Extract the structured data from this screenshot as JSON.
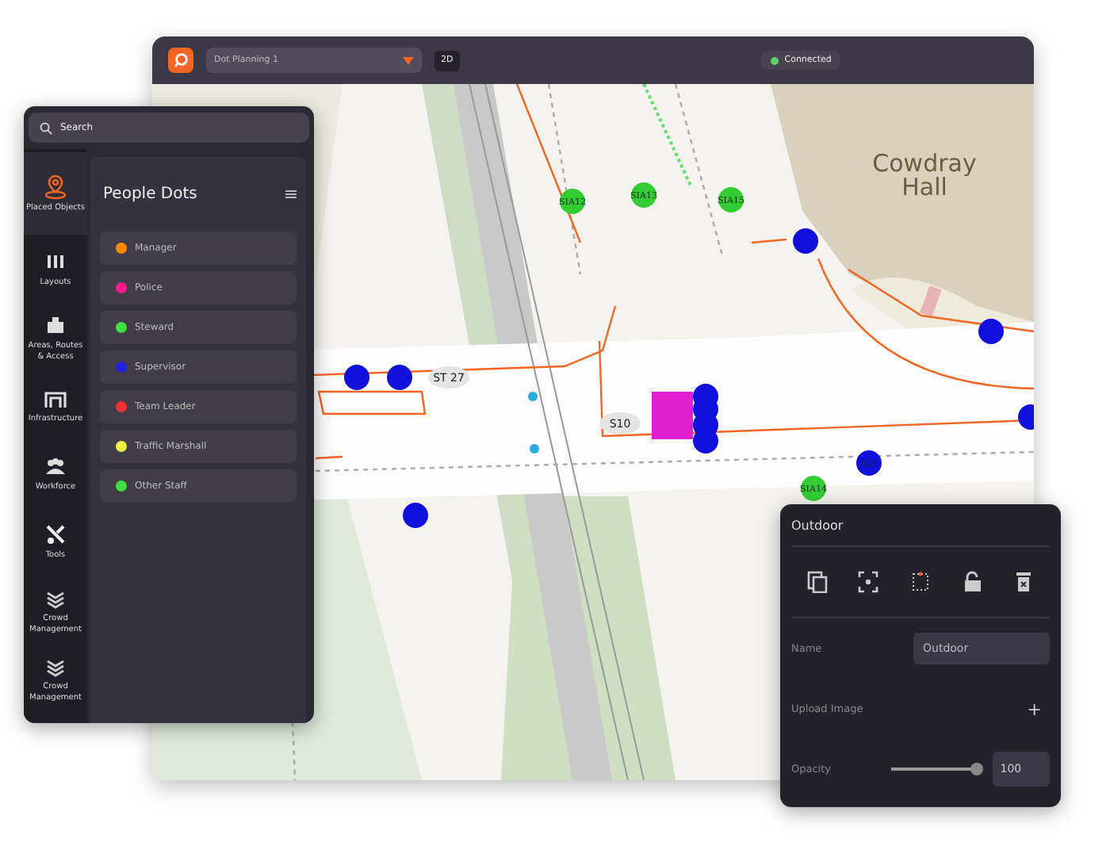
{
  "topbar": {
    "project": "Dot Planning 1",
    "view_button": "2D",
    "status": {
      "label": "Connected",
      "connected": true
    }
  },
  "map": {
    "building_label": [
      "Cowdray",
      "Hall"
    ],
    "markers": [
      {
        "label": "SIA12",
        "color": "#33cc33"
      },
      {
        "label": "SIA13",
        "color": "#33cc33"
      },
      {
        "label": "SIA15",
        "color": "#33cc33"
      },
      {
        "label": "SIA14",
        "color": "#33cc33"
      },
      {
        "label": "S21",
        "color": "#1010dd"
      },
      {
        "color": "#1010dd"
      },
      {
        "color": "#1010dd"
      },
      {
        "color": "#1010dd"
      },
      {
        "color": "#1010dd"
      },
      {
        "color": "#1010dd"
      },
      {
        "color": "#1010dd"
      },
      {
        "color": "#1010dd"
      },
      {
        "color": "#1010dd"
      },
      {
        "color": "#1010dd"
      },
      {
        "color": "#1010dd"
      }
    ],
    "tags": [
      "ST 27",
      "S10"
    ]
  },
  "sidebar": {
    "search": {
      "placeholder": "Search"
    },
    "nav": [
      {
        "kind": "pin",
        "label": "Placed Objects",
        "selected": true
      },
      {
        "kind": "layouts",
        "label": "Layouts",
        "selected": false
      },
      {
        "kind": "areas",
        "label": "Areas, Routes & Access",
        "selected": false
      },
      {
        "kind": "infra",
        "label": "Infrastructure",
        "selected": false
      },
      {
        "kind": "workforce",
        "label": "Workforce",
        "selected": false
      },
      {
        "kind": "tools",
        "label": "Tools",
        "selected": false
      },
      {
        "kind": "crowd",
        "label": "Crowd Management",
        "selected": false
      },
      {
        "kind": "crowd",
        "label": "Crowd Management",
        "selected": false
      }
    ],
    "panel_title": "People Dots",
    "people": [
      {
        "label": "Manager",
        "color": "#ff8a00"
      },
      {
        "label": "Police",
        "color": "#ff1a8c"
      },
      {
        "label": "Steward",
        "color": "#44dd44"
      },
      {
        "label": "Supervisor",
        "color": "#2222dd"
      },
      {
        "label": "Team Leader",
        "color": "#ee3333"
      },
      {
        "label": "Traffic Marshall",
        "color": "#eeee44"
      },
      {
        "label": "Other Staff",
        "color": "#44dd44"
      }
    ]
  },
  "properties": {
    "title": "Outdoor",
    "name_label": "Name",
    "name_value": "Outdoor",
    "upload_label": "Upload Image",
    "upload_button": "+",
    "opacity_label": "Opacity",
    "opacity": {
      "level": 0.96,
      "value": "100"
    }
  }
}
